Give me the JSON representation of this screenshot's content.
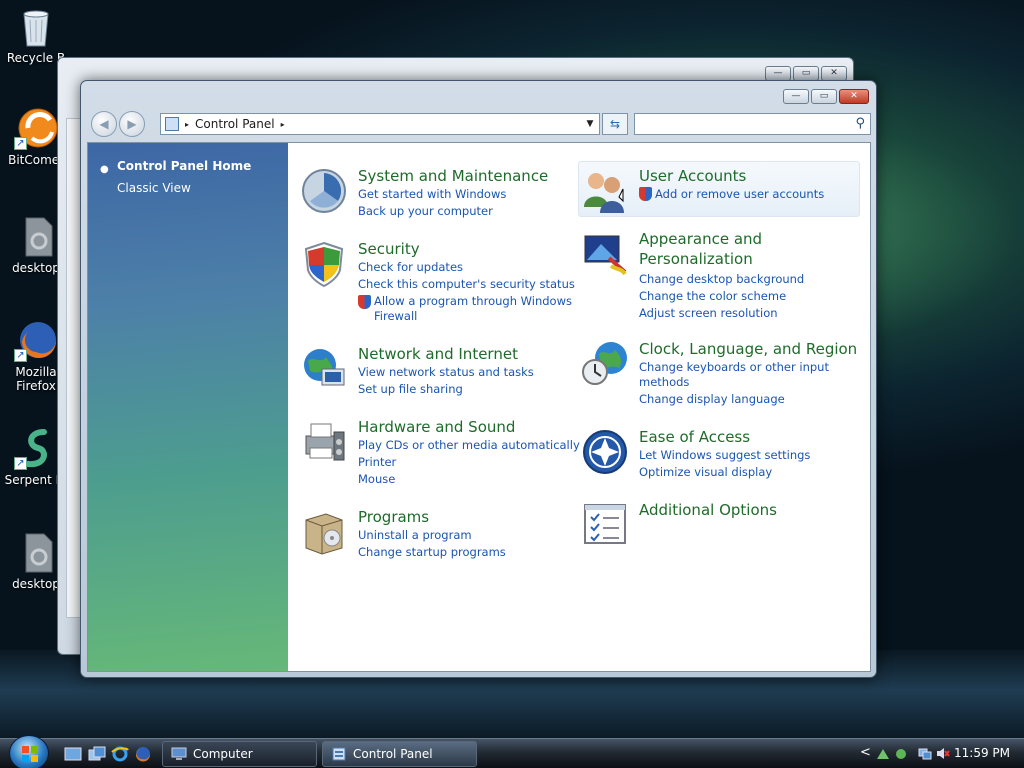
{
  "desktop": {
    "icons": [
      {
        "label": "Recycle B",
        "icon": "recycle-bin-icon"
      },
      {
        "label": "BitComet",
        "icon": "bitcomet-icon"
      },
      {
        "label": "desktop",
        "icon": "desktop-file-icon"
      },
      {
        "label": "Mozilla",
        "label2": "Firefox",
        "icon": "firefox-icon"
      },
      {
        "label": "Serpent IA",
        "icon": "serpent-icon"
      },
      {
        "label": "desktop",
        "icon": "desktop-file-icon"
      }
    ]
  },
  "window": {
    "address": {
      "path": "Control Panel",
      "arrow": "▸"
    },
    "search": {
      "placeholder": ""
    },
    "buttons": {
      "minimize": "—",
      "maximize": "▭",
      "close": "✕"
    },
    "sidebar": {
      "items": [
        {
          "label": "Control Panel Home"
        },
        {
          "label": "Classic View"
        }
      ]
    },
    "categories": {
      "system": {
        "title": "System and Maintenance",
        "links": [
          "Get started with Windows",
          "Back up your computer"
        ]
      },
      "security": {
        "title": "Security",
        "links": [
          "Check for updates",
          "Check this computer's security status",
          "Allow a program through Windows",
          "Firewall"
        ]
      },
      "network": {
        "title": "Network and Internet",
        "links": [
          "View network status and tasks",
          "Set up file sharing"
        ]
      },
      "hardware": {
        "title": "Hardware and Sound",
        "links": [
          "Play CDs or other media automatically",
          "Printer",
          "Mouse"
        ]
      },
      "programs": {
        "title": "Programs",
        "links": [
          "Uninstall a program",
          "Change startup programs"
        ]
      },
      "users": {
        "title": "User Accounts",
        "links": [
          "Add or remove user accounts"
        ]
      },
      "appearance": {
        "title1": "Appearance and",
        "title2": "Personalization",
        "links": [
          "Change desktop background",
          "Change the color scheme",
          "Adjust screen resolution"
        ]
      },
      "clock": {
        "title": "Clock, Language, and Region",
        "links": [
          "Change keyboards or other input",
          "methods",
          "Change display language"
        ]
      },
      "ease": {
        "title": "Ease of Access",
        "links": [
          "Let Windows suggest settings",
          "Optimize visual display"
        ]
      },
      "additional": {
        "title": "Additional Options"
      }
    }
  },
  "taskbar": {
    "buttons": [
      {
        "label": "Computer",
        "active": false
      },
      {
        "label": "Control Panel",
        "active": true
      }
    ],
    "tray_chevron": "<",
    "clock": "11:59 PM"
  },
  "colors": {
    "category_title": "#1f6b2a",
    "link": "#1a55b0",
    "sidebar_top": "#3d67a5",
    "sidebar_bottom": "#66b878"
  }
}
